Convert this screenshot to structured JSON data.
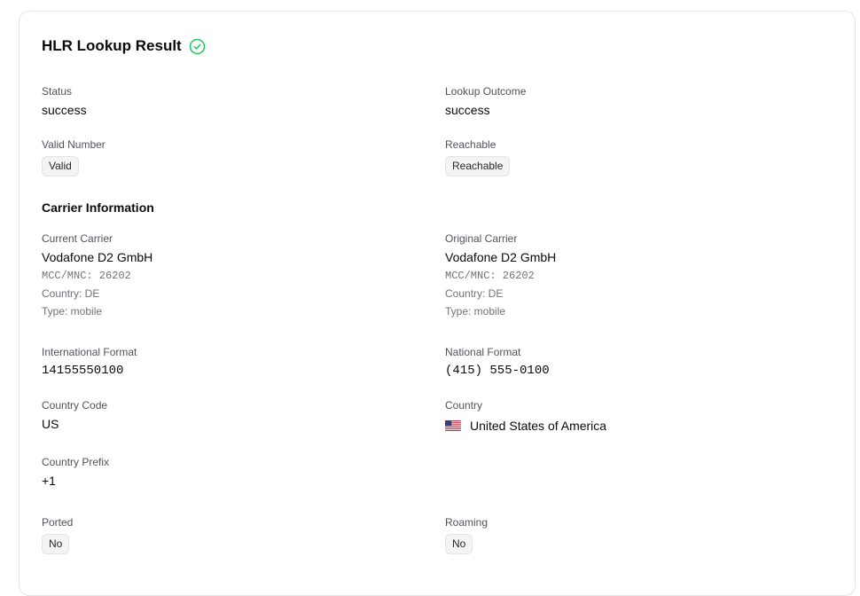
{
  "header": {
    "title": "HLR Lookup Result",
    "icon": "check-circle-icon",
    "icon_color": "#22c55e"
  },
  "fields": {
    "status": {
      "label": "Status",
      "value": "success"
    },
    "lookup_outcome": {
      "label": "Lookup Outcome",
      "value": "success"
    },
    "valid_number": {
      "label": "Valid Number",
      "badge": "Valid"
    },
    "reachable": {
      "label": "Reachable",
      "badge": "Reachable"
    }
  },
  "carrier_section": {
    "heading": "Carrier Information",
    "current": {
      "label": "Current Carrier",
      "name": "Vodafone D2 GmbH",
      "mcc_mnc": "MCC/MNC: 26202",
      "country": "Country: DE",
      "type": "Type: mobile"
    },
    "original": {
      "label": "Original Carrier",
      "name": "Vodafone D2 GmbH",
      "mcc_mnc": "MCC/MNC: 26202",
      "country": "Country: DE",
      "type": "Type: mobile"
    }
  },
  "number": {
    "international": {
      "label": "International Format",
      "value": "14155550100"
    },
    "national": {
      "label": "National Format",
      "value": "(415) 555-0100"
    },
    "country_code": {
      "label": "Country Code",
      "value": "US"
    },
    "country": {
      "label": "Country",
      "value": "United States of America",
      "flag": "us-flag-icon"
    },
    "country_prefix": {
      "label": "Country Prefix",
      "value": "+1"
    },
    "ported": {
      "label": "Ported",
      "badge": "No"
    },
    "roaming": {
      "label": "Roaming",
      "badge": "No"
    }
  }
}
